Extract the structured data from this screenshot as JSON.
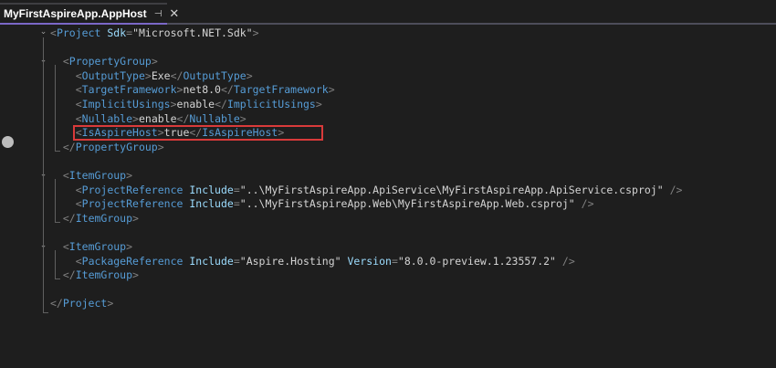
{
  "tab": {
    "title": "MyFirstAspireApp.AppHost",
    "pin_glyph": "⊣",
    "close_glyph": "✕"
  },
  "code_lines": [
    {
      "id": "l1",
      "parts": [
        [
          "b",
          "<"
        ],
        [
          "t",
          "Project"
        ],
        [
          "v",
          " "
        ],
        [
          "a",
          "Sdk"
        ],
        [
          "b",
          "="
        ],
        [
          "v",
          "\"Microsoft.NET.Sdk\""
        ],
        [
          "b",
          ">"
        ]
      ]
    },
    {
      "id": "l2",
      "parts": []
    },
    {
      "id": "l3",
      "parts": [
        [
          "v",
          "  "
        ],
        [
          "b",
          "<"
        ],
        [
          "t",
          "PropertyGroup"
        ],
        [
          "b",
          ">"
        ]
      ]
    },
    {
      "id": "l4",
      "parts": [
        [
          "v",
          "    "
        ],
        [
          "b",
          "<"
        ],
        [
          "t",
          "OutputType"
        ],
        [
          "b",
          ">"
        ],
        [
          "v",
          "Exe"
        ],
        [
          "b",
          "</"
        ],
        [
          "t",
          "OutputType"
        ],
        [
          "b",
          ">"
        ]
      ]
    },
    {
      "id": "l5",
      "parts": [
        [
          "v",
          "    "
        ],
        [
          "b",
          "<"
        ],
        [
          "t",
          "TargetFramework"
        ],
        [
          "b",
          ">"
        ],
        [
          "v",
          "net8.0"
        ],
        [
          "b",
          "</"
        ],
        [
          "t",
          "TargetFramework"
        ],
        [
          "b",
          ">"
        ]
      ]
    },
    {
      "id": "l6",
      "parts": [
        [
          "v",
          "    "
        ],
        [
          "b",
          "<"
        ],
        [
          "t",
          "ImplicitUsings"
        ],
        [
          "b",
          ">"
        ],
        [
          "v",
          "enable"
        ],
        [
          "b",
          "</"
        ],
        [
          "t",
          "ImplicitUsings"
        ],
        [
          "b",
          ">"
        ]
      ]
    },
    {
      "id": "l7",
      "parts": [
        [
          "v",
          "    "
        ],
        [
          "b",
          "<"
        ],
        [
          "t",
          "Nullable"
        ],
        [
          "b",
          ">"
        ],
        [
          "v",
          "enable"
        ],
        [
          "b",
          "</"
        ],
        [
          "t",
          "Nullable"
        ],
        [
          "b",
          ">"
        ]
      ]
    },
    {
      "id": "l8",
      "parts": [
        [
          "v",
          "    "
        ],
        [
          "b",
          "<"
        ],
        [
          "t",
          "IsAspireHost"
        ],
        [
          "b",
          ">"
        ],
        [
          "v",
          "true"
        ],
        [
          "b",
          "</"
        ],
        [
          "t",
          "IsAspireHost"
        ],
        [
          "b",
          ">"
        ]
      ]
    },
    {
      "id": "l9",
      "parts": [
        [
          "v",
          "  "
        ],
        [
          "b",
          "</"
        ],
        [
          "t",
          "PropertyGroup"
        ],
        [
          "b",
          ">"
        ]
      ]
    },
    {
      "id": "l10",
      "parts": []
    },
    {
      "id": "l11",
      "parts": [
        [
          "v",
          "  "
        ],
        [
          "b",
          "<"
        ],
        [
          "t",
          "ItemGroup"
        ],
        [
          "b",
          ">"
        ]
      ]
    },
    {
      "id": "l12",
      "parts": [
        [
          "v",
          "    "
        ],
        [
          "b",
          "<"
        ],
        [
          "t",
          "ProjectReference"
        ],
        [
          "v",
          " "
        ],
        [
          "a",
          "Include"
        ],
        [
          "b",
          "="
        ],
        [
          "v",
          "\"..\\MyFirstAspireApp.ApiService\\MyFirstAspireApp.ApiService.csproj\""
        ],
        [
          "v",
          " "
        ],
        [
          "b",
          "/>"
        ]
      ]
    },
    {
      "id": "l13",
      "parts": [
        [
          "v",
          "    "
        ],
        [
          "b",
          "<"
        ],
        [
          "t",
          "ProjectReference"
        ],
        [
          "v",
          " "
        ],
        [
          "a",
          "Include"
        ],
        [
          "b",
          "="
        ],
        [
          "v",
          "\"..\\MyFirstAspireApp.Web\\MyFirstAspireApp.Web.csproj\""
        ],
        [
          "v",
          " "
        ],
        [
          "b",
          "/>"
        ]
      ]
    },
    {
      "id": "l14",
      "parts": [
        [
          "v",
          "  "
        ],
        [
          "b",
          "</"
        ],
        [
          "t",
          "ItemGroup"
        ],
        [
          "b",
          ">"
        ]
      ]
    },
    {
      "id": "l15",
      "parts": []
    },
    {
      "id": "l16",
      "parts": [
        [
          "v",
          "  "
        ],
        [
          "b",
          "<"
        ],
        [
          "t",
          "ItemGroup"
        ],
        [
          "b",
          ">"
        ]
      ]
    },
    {
      "id": "l17",
      "parts": [
        [
          "v",
          "    "
        ],
        [
          "b",
          "<"
        ],
        [
          "t",
          "PackageReference"
        ],
        [
          "v",
          " "
        ],
        [
          "a",
          "Include"
        ],
        [
          "b",
          "="
        ],
        [
          "v",
          "\"Aspire.Hosting\""
        ],
        [
          "v",
          " "
        ],
        [
          "a",
          "Version"
        ],
        [
          "b",
          "="
        ],
        [
          "v",
          "\"8.0.0-preview.1.23557.2\""
        ],
        [
          "v",
          " "
        ],
        [
          "b",
          "/>"
        ]
      ]
    },
    {
      "id": "l18",
      "parts": [
        [
          "v",
          "  "
        ],
        [
          "b",
          "</"
        ],
        [
          "t",
          "ItemGroup"
        ],
        [
          "b",
          ">"
        ]
      ]
    },
    {
      "id": "l19",
      "parts": []
    },
    {
      "id": "l20",
      "parts": [
        [
          "b",
          "</"
        ],
        [
          "t",
          "Project"
        ],
        [
          "b",
          ">"
        ]
      ]
    }
  ],
  "colors": {
    "background": "#1e1e1e",
    "tag": "#569cd6",
    "attribute": "#9cdcfe",
    "bracket": "#808080",
    "text": "#d4d4d4",
    "highlight_border": "#d93a3a"
  },
  "icons": {
    "fold": "chevron-down-icon",
    "breakpoint": "breakpoint-icon"
  }
}
